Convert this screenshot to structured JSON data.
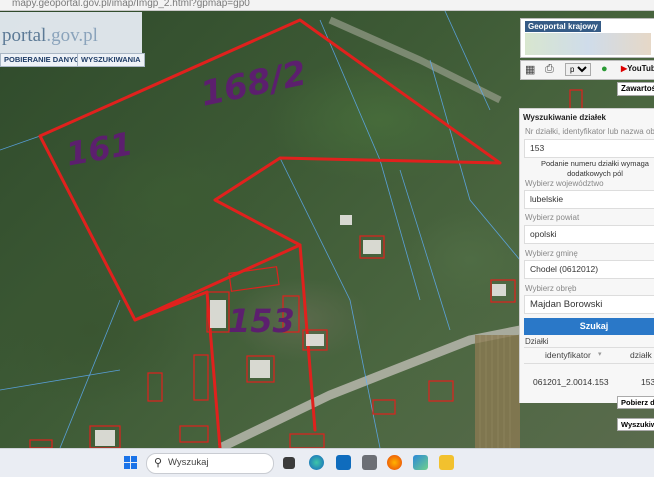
{
  "browser": {
    "url": "mapy.geoportal.gov.pl/imap/Imgp_2.html?gpmap=gp0"
  },
  "header": {
    "logo_main": "portal",
    "logo_sub": ".gov.pl",
    "menu": [
      "POBIERANIE DANYCH",
      "WYSZUKIWANIA"
    ]
  },
  "badge": {
    "title": "Geoportal krajowy"
  },
  "tools": {
    "language": "pol",
    "youtube_label": "YouTube",
    "contents_label": "Zawartoś"
  },
  "search_panel": {
    "title": "Wyszukiwanie działek",
    "id_label": "Nr działki, identyfikator lub nazwa obr",
    "id_value": "153",
    "note": "Podanie numeru działki wymaga dodatkowych pól",
    "voivodeship_label": "Wybierz województwo",
    "voivodeship_value": "lubelskie",
    "county_label": "Wybierz powiat",
    "county_value": "opolski",
    "commune_label": "Wybierz gminę",
    "commune_value": "Chodel (0612012)",
    "precinct_label": "Wybierz obręb",
    "precinct_value": "Majdan Borowski",
    "search_button": "Szukaj",
    "results_label": "Działki",
    "columns": [
      "identyfikator",
      "działk"
    ],
    "rows": [
      {
        "identyfikator": "061201_2.0014.153",
        "dzialka": "153"
      }
    ],
    "download_label": "Pobierz d",
    "search2_label": "Wyszukiw"
  },
  "annotations": [
    "168/2",
    "161",
    "153"
  ],
  "taskbar": {
    "search_placeholder": "Wyszukaj"
  },
  "colors": {
    "parcel_line": "#e0211d",
    "annotation": "#5c1f6e",
    "primary_button": "#2a78c8",
    "header_title_bg": "#355b86"
  }
}
